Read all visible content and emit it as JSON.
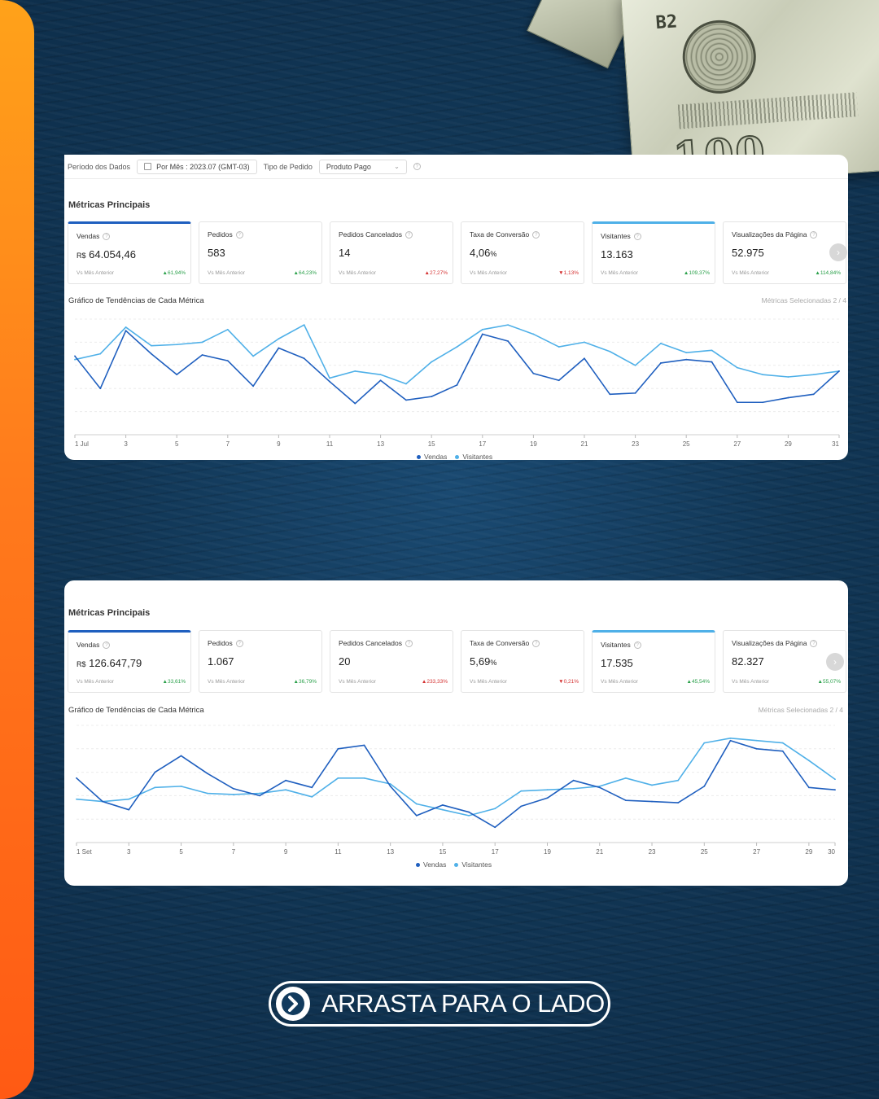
{
  "panel1": {
    "filters": {
      "period_label": "Período dos Dados",
      "period_value": "Por Mês :  2023.07 (GMT-03)",
      "order_type_label": "Tipo de Pedido",
      "order_type_value": "Produto Pago"
    },
    "section_title": "Métricas Principais",
    "cards": [
      {
        "title": "Vendas",
        "currency": "R$",
        "value": "64.054,46",
        "compare": "Vs Mês Anterior",
        "pct": "61,94%",
        "dir": "up",
        "selected": "dark"
      },
      {
        "title": "Pedidos",
        "currency": "",
        "value": "583",
        "compare": "Vs Mês Anterior",
        "pct": "64,23%",
        "dir": "up",
        "selected": ""
      },
      {
        "title": "Pedidos Cancelados",
        "currency": "",
        "value": "14",
        "compare": "Vs Mês Anterior",
        "pct": "27,27%",
        "dir": "up-red",
        "selected": ""
      },
      {
        "title": "Taxa de Conversão",
        "currency": "",
        "value": "4,06",
        "unit": "%",
        "compare": "Vs Mês Anterior",
        "pct": "1,13%",
        "dir": "down",
        "selected": ""
      },
      {
        "title": "Visitantes",
        "currency": "",
        "value": "13.163",
        "compare": "Vs Mês Anterior",
        "pct": "109,37%",
        "dir": "up",
        "selected": "light"
      },
      {
        "title": "Visualizações da Página",
        "currency": "",
        "value": "52.975",
        "compare": "Vs Mês Anterior",
        "pct": "114,84%",
        "dir": "up",
        "selected": ""
      }
    ],
    "trend_title": "Gráfico de Tendências de Cada Métrica",
    "selected_metrics": "Métricas Selecionadas 2 / 4",
    "legend": [
      "Vendas",
      "Visitantes"
    ]
  },
  "panel2": {
    "section_title": "Métricas Principais",
    "cards": [
      {
        "title": "Vendas",
        "currency": "R$",
        "value": "126.647,79",
        "compare": "Vs Mês Anterior",
        "pct": "33,61%",
        "dir": "up",
        "selected": "dark"
      },
      {
        "title": "Pedidos",
        "currency": "",
        "value": "1.067",
        "compare": "Vs Mês Anterior",
        "pct": "36,79%",
        "dir": "up",
        "selected": ""
      },
      {
        "title": "Pedidos Cancelados",
        "currency": "",
        "value": "20",
        "compare": "Vs Mês Anterior",
        "pct": "233,33%",
        "dir": "up-red",
        "selected": ""
      },
      {
        "title": "Taxa de Conversão",
        "currency": "",
        "value": "5,69",
        "unit": "%",
        "compare": "Vs Mês Anterior",
        "pct": "0,21%",
        "dir": "down",
        "selected": ""
      },
      {
        "title": "Visitantes",
        "currency": "",
        "value": "17.535",
        "compare": "Vs Mês Anterior",
        "pct": "45,54%",
        "dir": "up",
        "selected": "light"
      },
      {
        "title": "Visualizações da Página",
        "currency": "",
        "value": "82.327",
        "compare": "Vs Mês Anterior",
        "pct": "55,07%",
        "dir": "up",
        "selected": ""
      }
    ],
    "trend_title": "Gráfico de Tendências de Cada Métrica",
    "selected_metrics": "Métricas Selecionadas 2 / 4",
    "legend": [
      "Vendas",
      "Visitantes"
    ]
  },
  "cta": {
    "label": "ARRASTA PARA O LADO"
  },
  "money": {
    "serial": "B2",
    "denomination": "100"
  },
  "colors": {
    "vendas": "#1f5fbf",
    "visitantes": "#4fb0e8",
    "up": "#2aa04a",
    "down": "#d43030",
    "accent_orange": "#ff7a1c"
  },
  "chart_data": [
    {
      "type": "line",
      "x": [
        1,
        2,
        3,
        4,
        5,
        6,
        7,
        8,
        9,
        10,
        11,
        12,
        13,
        14,
        15,
        16,
        17,
        18,
        19,
        20,
        21,
        22,
        23,
        24,
        25,
        26,
        27,
        28,
        29,
        30,
        31
      ],
      "xticks": [
        "1 Jul",
        "3",
        "5",
        "7",
        "9",
        "11",
        "13",
        "15",
        "17",
        "19",
        "21",
        "23",
        "25",
        "27",
        "29",
        "31"
      ],
      "ylim": [
        0,
        100
      ],
      "series": [
        {
          "name": "Vendas",
          "values": [
            68,
            40,
            90,
            70,
            52,
            69,
            64,
            42,
            75,
            66,
            46,
            27,
            47,
            30,
            33,
            43,
            87,
            81,
            53,
            47,
            66,
            35,
            36,
            62,
            65,
            63,
            28,
            28,
            32,
            35,
            55
          ]
        },
        {
          "name": "Visitantes",
          "values": [
            65,
            70,
            93,
            77,
            78,
            80,
            91,
            68,
            83,
            95,
            49,
            55,
            52,
            44,
            63,
            76,
            91,
            95,
            87,
            76,
            80,
            72,
            60,
            79,
            71,
            73,
            58,
            52,
            50,
            52,
            55
          ]
        }
      ]
    },
    {
      "type": "line",
      "x": [
        1,
        2,
        3,
        4,
        5,
        6,
        7,
        8,
        9,
        10,
        11,
        12,
        13,
        14,
        15,
        16,
        17,
        18,
        19,
        20,
        21,
        22,
        23,
        24,
        25,
        26,
        27,
        28,
        29,
        30
      ],
      "xticks": [
        "1 Set",
        "3",
        "5",
        "7",
        "9",
        "11",
        "13",
        "15",
        "17",
        "19",
        "21",
        "23",
        "25",
        "27",
        "29",
        "30"
      ],
      "ylim": [
        0,
        100
      ],
      "series": [
        {
          "name": "Vendas",
          "values": [
            55,
            35,
            28,
            60,
            74,
            59,
            46,
            40,
            53,
            47,
            80,
            83,
            48,
            23,
            32,
            26,
            13,
            31,
            38,
            53,
            47,
            36,
            35,
            34,
            48,
            87,
            80,
            78,
            47,
            45
          ]
        },
        {
          "name": "Visitantes",
          "values": [
            37,
            35,
            37,
            47,
            48,
            42,
            41,
            42,
            45,
            39,
            55,
            55,
            50,
            33,
            28,
            23,
            29,
            44,
            45,
            46,
            48,
            55,
            49,
            53,
            85,
            89,
            87,
            85,
            70,
            54
          ]
        }
      ]
    }
  ]
}
